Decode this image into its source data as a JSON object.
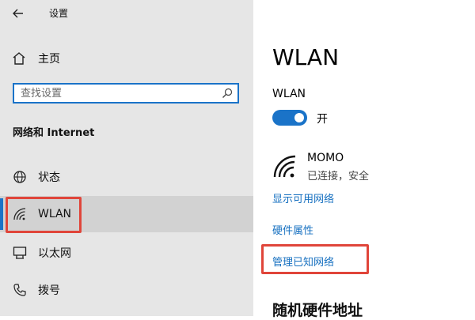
{
  "window": {
    "title": "设置"
  },
  "sidebar": {
    "home_label": "主页",
    "search_placeholder": "查找设置",
    "section_title": "网络和 Internet",
    "items": [
      {
        "label": "状态",
        "icon": "globe-icon"
      },
      {
        "label": "WLAN",
        "icon": "wifi-icon",
        "selected": true
      },
      {
        "label": "以太网",
        "icon": "ethernet-icon"
      },
      {
        "label": "拨号",
        "icon": "dialup-icon"
      }
    ]
  },
  "main": {
    "title": "WLAN",
    "wlan_label": "WLAN",
    "toggle_state": "开",
    "network": {
      "name": "MOMO",
      "status": "已连接，安全"
    },
    "links": [
      "显示可用网络",
      "硬件属性",
      "管理已知网络"
    ],
    "section_title": "随机硬件地址"
  },
  "colors": {
    "accent": "#1a73c8",
    "highlight_box": "#e0453a",
    "link": "#1670c0",
    "sidebar_bg": "#e6e6e6"
  }
}
